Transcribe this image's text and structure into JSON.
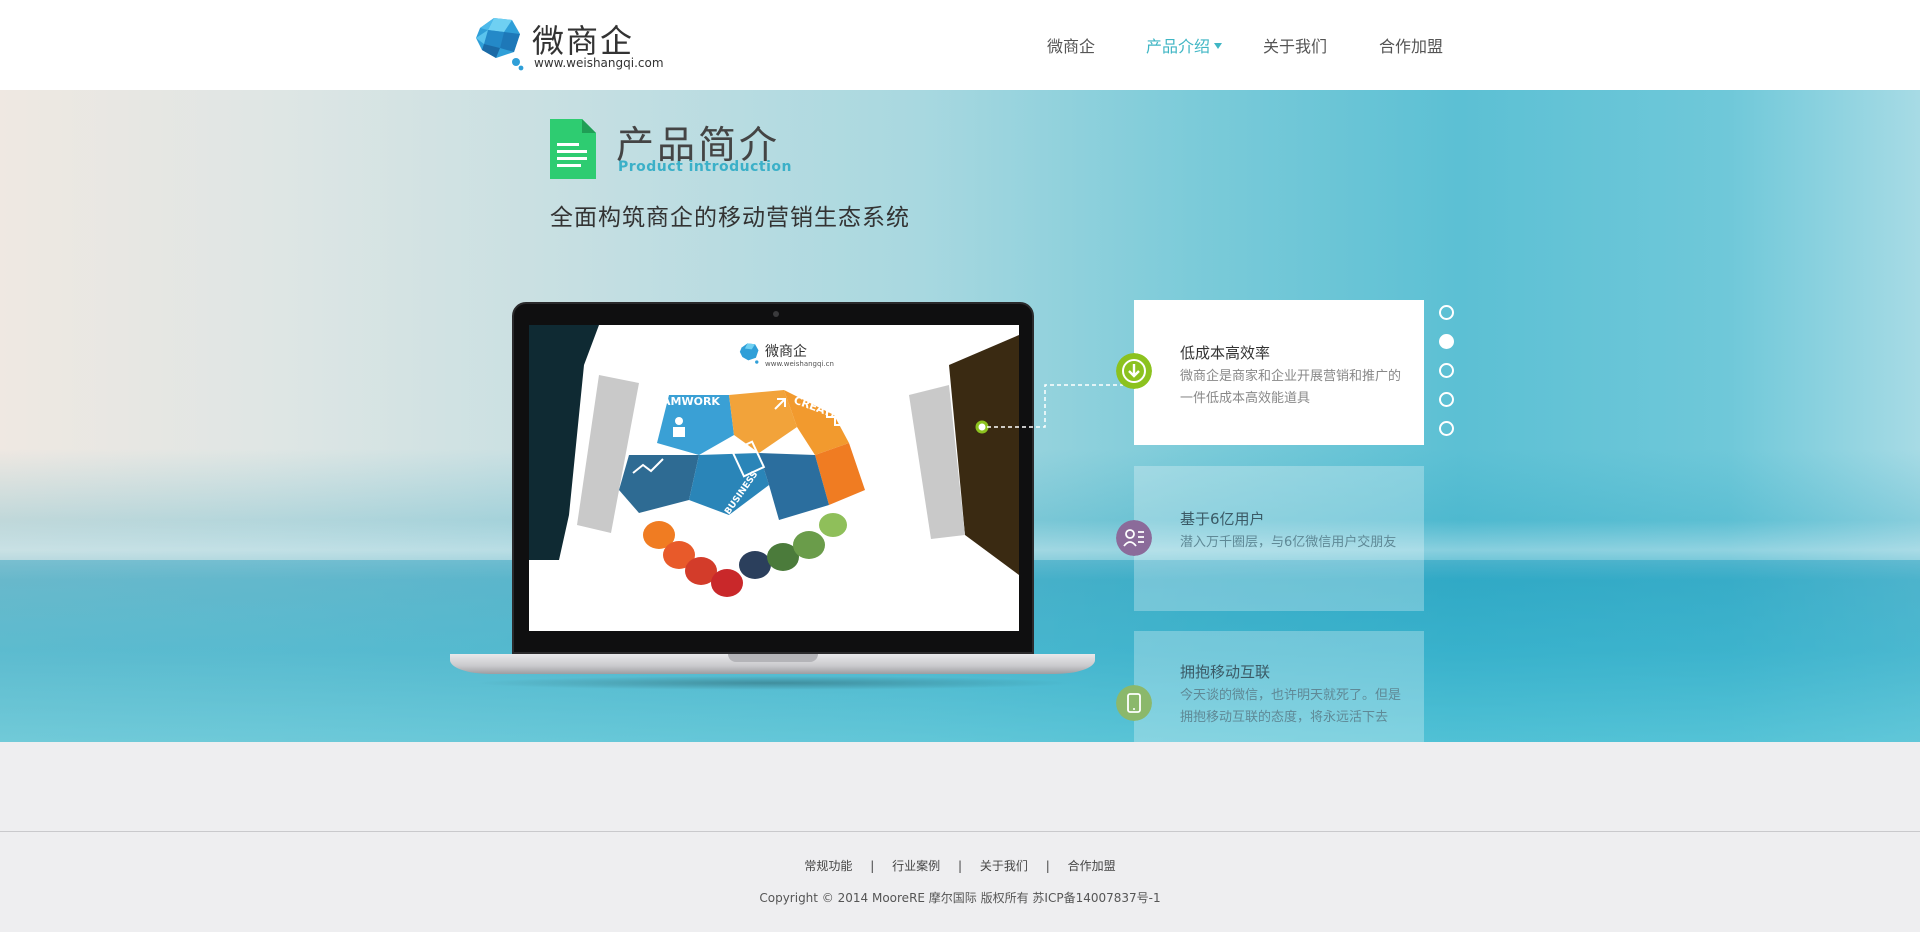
{
  "header": {
    "logo_title": "微商企",
    "logo_url": "www.weishangqi.com",
    "nav": [
      {
        "label": "微商企",
        "active": false
      },
      {
        "label": "产品介绍",
        "active": true,
        "has_dropdown": true
      },
      {
        "label": "关于我们",
        "active": false
      },
      {
        "label": "合作加盟",
        "active": false
      }
    ]
  },
  "banner": {
    "section_title": "产品简介",
    "section_subtitle": "Product introduction",
    "tagline": "全面构筑商企的移动营销生态系统",
    "screen": {
      "logo_title": "微商企",
      "logo_url": "www.weishangqi.cn",
      "puzzle_words": [
        "TEAMWORK",
        "CREATIVE",
        "IDEA",
        "BUSINESS"
      ]
    },
    "features": [
      {
        "title": "低成本高效率",
        "desc": "微商企是商家和企业开展营销和推广的一件低成本高效能道具",
        "icon": "download-icon",
        "color": "#8cc21f",
        "active": true
      },
      {
        "title": "基于6亿用户",
        "desc": "潜入万千圈层，与6亿微信用户交朋友",
        "icon": "user-list-icon",
        "color": "#8b6b9a",
        "active": false
      },
      {
        "title": "拥抱移动互联",
        "desc": "今天谈的微信，也许明天就死了。但是拥抱移动互联的态度，将永远活下去",
        "icon": "phone-icon",
        "color": "#8bb86b",
        "active": false
      }
    ],
    "pager": {
      "count": 5,
      "active_index": 1
    }
  },
  "footer": {
    "links": [
      "常规功能",
      "行业案例",
      "关于我们",
      "合作加盟"
    ],
    "separator": "|",
    "copyright": "Copyright © 2014   MooreRE 摩尔国际   版权所有 苏ICP备14007837号-1"
  },
  "colors": {
    "accent": "#3fb6c4",
    "subtitle": "#3bb0c8",
    "doc_icon": "#2ecc71"
  }
}
